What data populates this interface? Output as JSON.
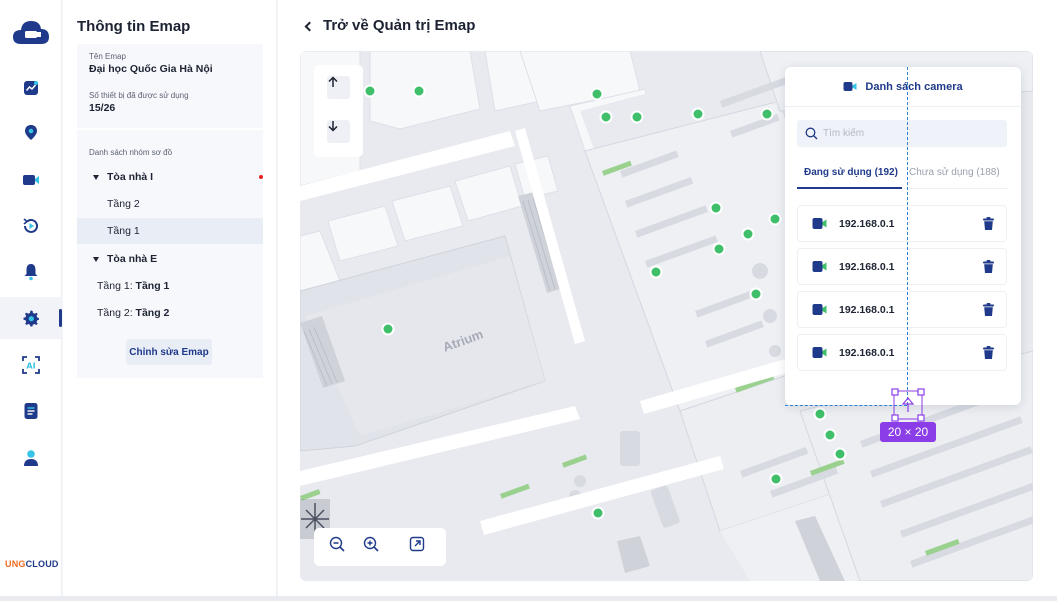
{
  "brand": {
    "part1": "UNG",
    "part2": "CLOUD"
  },
  "rail": {
    "items": [
      {
        "name": "dashboard-icon"
      },
      {
        "name": "location-pin-icon"
      },
      {
        "name": "camera-icon"
      },
      {
        "name": "playback-icon"
      },
      {
        "name": "bell-icon"
      },
      {
        "name": "settings-gear-icon",
        "active": true
      },
      {
        "name": "ai-scan-icon"
      },
      {
        "name": "document-icon"
      },
      {
        "name": "user-icon"
      }
    ]
  },
  "info": {
    "title": "Thông tin Emap",
    "name_label": "Tên Emap",
    "name_value": "Đại học Quốc Gia Hà Nội",
    "devices_label": "Số thiết bị đã được sử dụng",
    "devices_value": "15/26",
    "groups_label": "Danh sách nhóm sơ đồ",
    "tree": {
      "building1": "Tòa nhà I",
      "b1_floor2": "Tầng 2",
      "b1_floor1": "Tầng 1",
      "building2": "Tòa nhà E",
      "row4_prefix": "Tầng 1: ",
      "row4_bold": "Tầng 1",
      "row5_prefix": "Tầng 2: ",
      "row5_bold": "Tầng 2"
    },
    "edit_button": "Chỉnh sửa Emap"
  },
  "header": {
    "back_label": "Trở về Quản trị Emap"
  },
  "map": {
    "label": "Atrium"
  },
  "camera_panel": {
    "title": "Danh sách camera",
    "search_placeholder": "Tìm kiếm",
    "tab_used": "Đang sử dụng (192)",
    "tab_unused": "Chưa sử dụng (188)",
    "cameras": [
      "192.168.0.1",
      "192.168.0.1",
      "192.168.0.1",
      "192.168.0.1"
    ]
  },
  "selection": {
    "size_label": "20 × 20"
  },
  "colors": {
    "primary": "#1f3a8a",
    "accent_purple": "#8b3ee8",
    "camera_green": "#3fbf6a",
    "delete_blue": "#1f3a8a"
  }
}
